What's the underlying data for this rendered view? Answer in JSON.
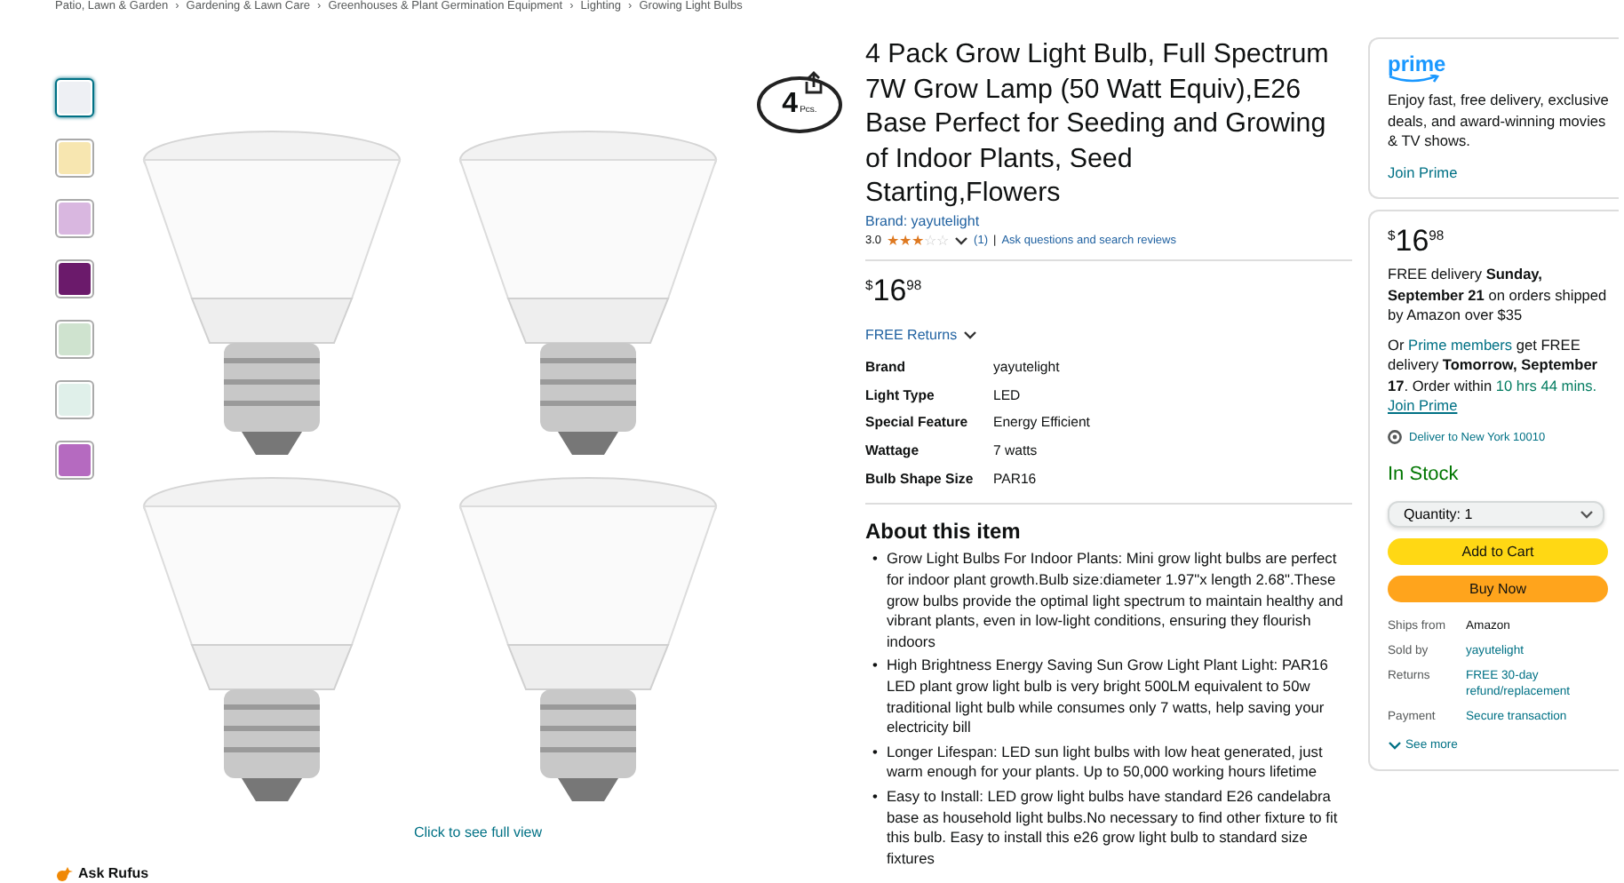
{
  "breadcrumb": {
    "separator": "›",
    "items": [
      "Patio, Lawn & Garden",
      "Gardening & Lawn Care",
      "Greenhouses & Plant Germination Equipment",
      "Lighting",
      "Growing Light Bulbs"
    ]
  },
  "gallery": {
    "thumbnails": [
      {
        "selected": true
      },
      {
        "selected": false
      },
      {
        "selected": false
      },
      {
        "selected": false
      },
      {
        "selected": false
      },
      {
        "selected": false
      },
      {
        "selected": false
      }
    ],
    "badge": {
      "count": "4",
      "unit": "Pcs."
    },
    "full_view_link": "Click to see full view",
    "rufus_label": "Ask Rufus"
  },
  "product": {
    "title": "4 Pack Grow Light Bulb, Full Spectrum 7W Grow Lamp (50 Watt Equiv),E26 Base Perfect for Seeding and Growing of Indoor Plants, Seed Starting,Flowers",
    "brand_link": "Brand: yayutelight",
    "rating": {
      "score": "3.0",
      "stars": 3,
      "count": "(1)",
      "separator": "|",
      "ask_link": "Ask questions and search reviews"
    },
    "price": {
      "currency": "$",
      "whole": "16",
      "fraction": "98"
    },
    "returns": "FREE Returns",
    "specs": [
      {
        "label": "Brand",
        "value": "yayutelight"
      },
      {
        "label": "Light Type",
        "value": "LED"
      },
      {
        "label": "Special Feature",
        "value": "Energy Efficient"
      },
      {
        "label": "Wattage",
        "value": "7 watts"
      },
      {
        "label": "Bulb Shape Size",
        "value": "PAR16"
      }
    ],
    "about_heading": "About this item",
    "bullet_marker": "•",
    "bullets": [
      "Grow Light Bulbs For Indoor Plants: Mini grow light bulbs are perfect for indoor plant growth.Bulb size:diameter 1.97\"x length 2.68\".These grow bulbs provide the optimal light spectrum to maintain healthy and vibrant plants, even in low-light conditions, ensuring they flourish indoors",
      "High Brightness Energy Saving Sun Grow Light Plant Light: PAR16 LED plant grow light bulb is very bright 500LM equivalent to 50w traditional light bulb while consumes only 7 watts, help saving your electricity bill",
      "Longer Lifespan: LED sun light bulbs with low heat generated, just warm enough for your plants. Up to 50,000 working hours lifetime",
      "Easy to Install: LED grow light bulbs have standard E26 candelabra base as household light bulbs.No necessary to find other fixture to fit this bulb. Easy to install this e26 grow light bulb to standard size fixtures"
    ]
  },
  "prime_card": {
    "logo": "prime",
    "text": "Enjoy fast, free delivery, exclusive deals, and award-winning movies & TV shows.",
    "link": "Join Prime"
  },
  "buy_box": {
    "price": {
      "currency": "$",
      "whole": "16",
      "fraction": "98"
    },
    "delivery": "FREE delivery **Sunday, September 21** on orders shipped by Amazon over $35",
    "prime_offer": {
      "lead": "Or",
      "members_link": "Prime members",
      "middle": "get FREE delivery **Tomorrow, September 17**. Order within",
      "countdown": "10 hrs 44 mins.",
      "join_link": "Join Prime"
    },
    "location": "Deliver to New York 10010",
    "stock": "In Stock",
    "quantity": "Quantity: 1",
    "add_to_cart": "Add to Cart",
    "buy_now": "Buy Now",
    "details": [
      {
        "label": "Ships from",
        "value": "Amazon",
        "kind": "text"
      },
      {
        "label": "Sold by",
        "value": "yayutelight",
        "kind": "link"
      },
      {
        "label": "Returns",
        "value": "FREE 30-day refund/replacement",
        "kind": "link"
      },
      {
        "label": "Payment",
        "value": "Secure transaction",
        "kind": "link"
      }
    ],
    "see_more": "See more"
  }
}
